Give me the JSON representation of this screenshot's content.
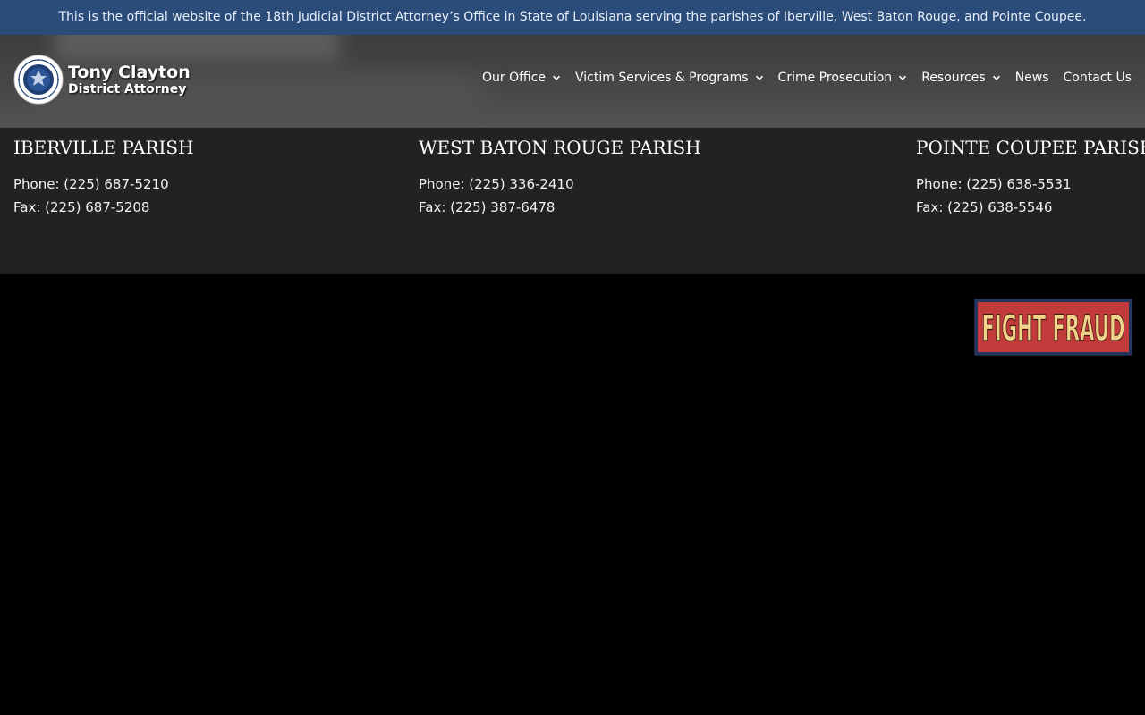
{
  "topbar": {
    "notice": "This is the official website of the 18th Judicial District Attorney’s Office in State of Louisiana serving the parishes of Iberville, West Baton Rouge, and Pointe Coupee."
  },
  "header": {
    "logo": {
      "name": "Tony Clayton",
      "title": "District Attorney",
      "icon": "state-seal-icon"
    },
    "nav": [
      {
        "label": "Our Office",
        "has_dropdown": true
      },
      {
        "label": "Victim Services & Programs",
        "has_dropdown": true
      },
      {
        "label": "Crime Prosecution",
        "has_dropdown": true
      },
      {
        "label": "Resources",
        "has_dropdown": true
      },
      {
        "label": "News",
        "has_dropdown": false
      },
      {
        "label": "Contact Us",
        "has_dropdown": false
      }
    ]
  },
  "parishes": [
    {
      "name": "IBERVILLE PARISH",
      "phone": "Phone: (225) 687-5210",
      "fax": "Fax: (225) 687-5208"
    },
    {
      "name": "WEST BATON ROUGE PARISH",
      "phone": "Phone: (225) 336-2410",
      "fax": "Fax: (225) 387-6478"
    },
    {
      "name": "POINTE COUPEE PARISH",
      "phone": "Phone: (225) 638-5531",
      "fax": "Fax: (225) 638-5546"
    }
  ],
  "badge": {
    "text": "FIGHT FRAUD",
    "bg_color": "#c33a3a",
    "text_color": "#f3d38a",
    "border_color": "#24345e"
  },
  "colors": {
    "topbar_bg": "#2b4b78",
    "header_bg": "#474747",
    "parish_bg": "#222222",
    "page_bg": "#000000"
  }
}
